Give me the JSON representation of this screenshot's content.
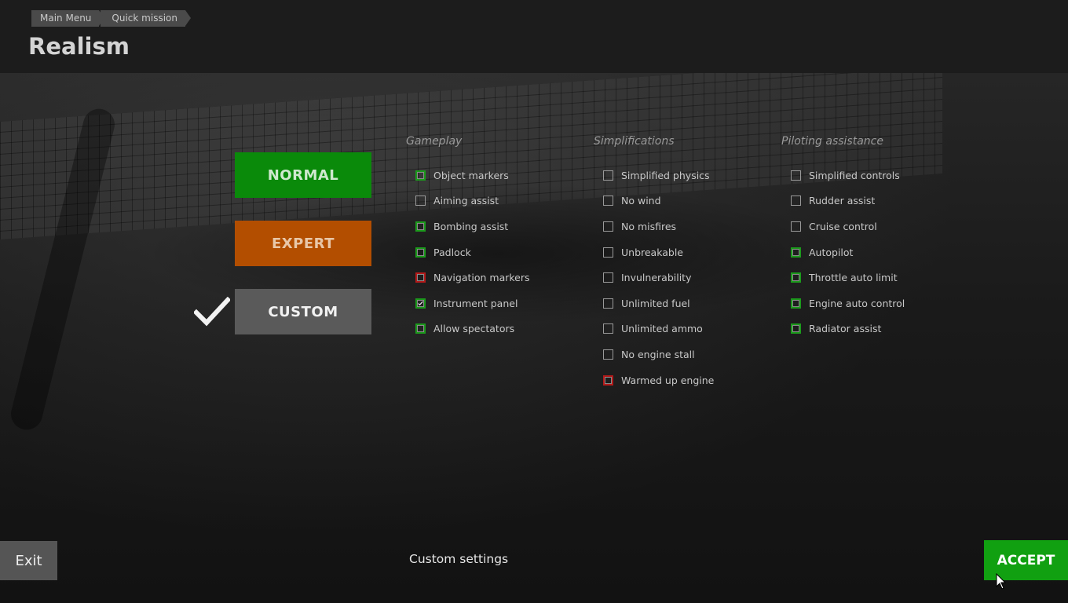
{
  "breadcrumb": [
    "Main Menu",
    "Quick mission"
  ],
  "page_title": "Realism",
  "presets": {
    "normal": "NORMAL",
    "expert": "EXPERT",
    "custom": "CUSTOM",
    "selected": "CUSTOM"
  },
  "columns": {
    "gameplay": {
      "title": "Gameplay",
      "options": [
        {
          "label": "Object markers",
          "state": "green",
          "checked": false
        },
        {
          "label": "Aiming assist",
          "state": "default",
          "checked": false
        },
        {
          "label": "Bombing assist",
          "state": "green",
          "checked": false
        },
        {
          "label": "Padlock",
          "state": "green",
          "checked": false
        },
        {
          "label": "Navigation markers",
          "state": "red",
          "checked": false
        },
        {
          "label": "Instrument panel",
          "state": "green",
          "checked": true
        },
        {
          "label": "Allow spectators",
          "state": "green",
          "checked": false
        }
      ]
    },
    "simplifications": {
      "title": "Simplifications",
      "options": [
        {
          "label": "Simplified physics",
          "state": "default",
          "checked": false
        },
        {
          "label": "No wind",
          "state": "default",
          "checked": false
        },
        {
          "label": "No misfires",
          "state": "default",
          "checked": false
        },
        {
          "label": "Unbreakable",
          "state": "default",
          "checked": false
        },
        {
          "label": "Invulnerability",
          "state": "default",
          "checked": false
        },
        {
          "label": "Unlimited fuel",
          "state": "default",
          "checked": false
        },
        {
          "label": "Unlimited ammo",
          "state": "default",
          "checked": false
        },
        {
          "label": "No engine stall",
          "state": "default",
          "checked": false
        },
        {
          "label": "Warmed up engine",
          "state": "red",
          "checked": false
        }
      ]
    },
    "piloting": {
      "title": "Piloting assistance",
      "options": [
        {
          "label": "Simplified controls",
          "state": "default",
          "checked": false
        },
        {
          "label": "Rudder assist",
          "state": "default",
          "checked": false
        },
        {
          "label": "Cruise control",
          "state": "default",
          "checked": false
        },
        {
          "label": "Autopilot",
          "state": "green",
          "checked": false
        },
        {
          "label": "Throttle auto limit",
          "state": "green",
          "checked": false
        },
        {
          "label": "Engine auto control",
          "state": "green",
          "checked": false
        },
        {
          "label": "Radiator assist",
          "state": "green",
          "checked": false
        }
      ]
    }
  },
  "footer": {
    "exit_label": "Exit",
    "status_label": "Custom settings",
    "accept_label": "ACCEPT"
  },
  "colors": {
    "normal": "#0a8a0a",
    "expert": "#b34e00",
    "custom": "#5a5a5a",
    "accept": "#11a011",
    "box_green": "#1c9a1c",
    "box_red": "#b31a1a"
  },
  "icons": {
    "selected": "checkmark-icon",
    "cursor": "mouse-cursor-icon"
  }
}
